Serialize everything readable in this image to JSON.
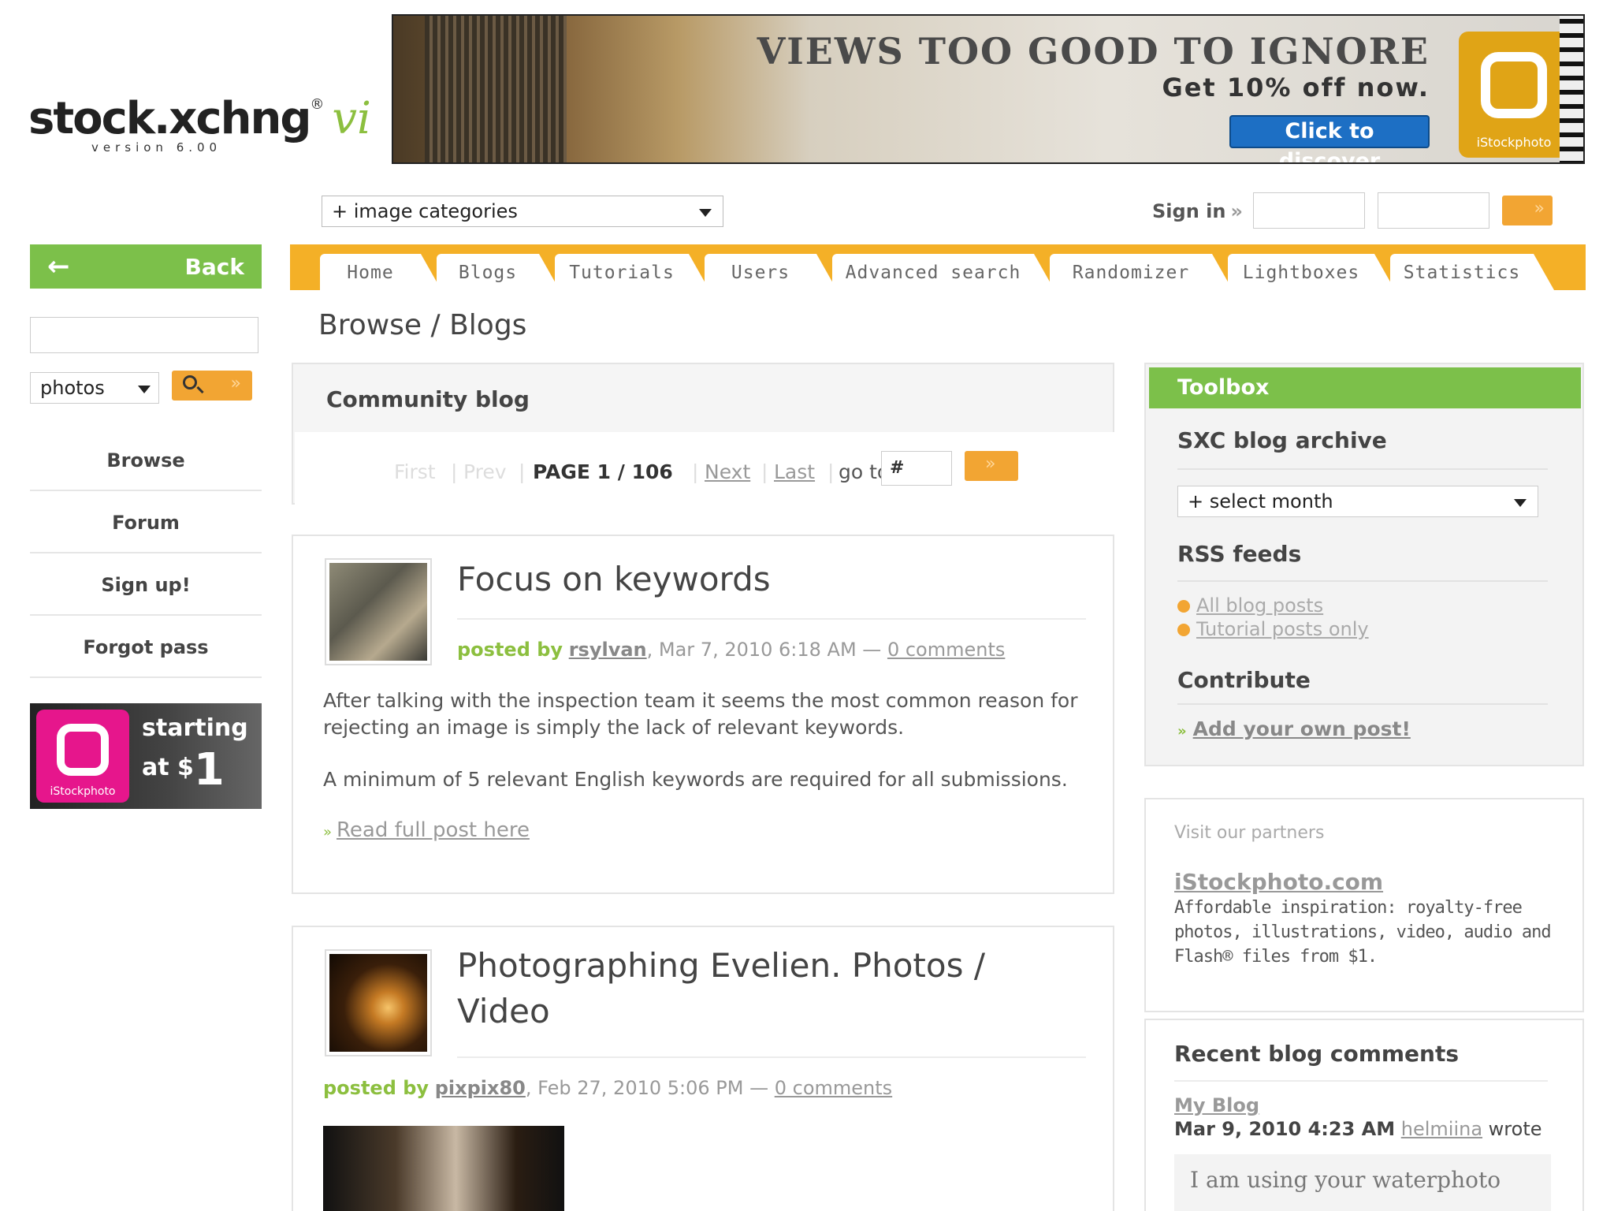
{
  "logo": {
    "name": "stock.xchng",
    "registered": "®",
    "suffix": "vi",
    "version": "version 6.00"
  },
  "banner": {
    "headline": "VIEWS TOO GOOD TO IGNORE",
    "subline": "Get 10% off now.",
    "cta": "Click to discover",
    "brand": "iStockphoto"
  },
  "header": {
    "category_select": "+ image categories",
    "signin_label": "Sign in",
    "signin_arrow": "»"
  },
  "left": {
    "back_label": "Back",
    "type_select": "photos",
    "nav": [
      "Browse",
      "Forum",
      "Sign up!",
      "Forgot pass"
    ],
    "ad": {
      "line1": "starting",
      "line2_prefix": "at $",
      "line2_big": "1",
      "brand": "iStockphoto"
    }
  },
  "tabs": [
    "Home",
    "Blogs",
    "Tutorials",
    "Users",
    "Advanced search",
    "Randomizer",
    "Lightboxes",
    "Statistics"
  ],
  "page_title": "Browse / Blogs",
  "community": {
    "heading": "Community blog",
    "first": "First",
    "prev": "Prev",
    "sep": "|",
    "page_label": "PAGE 1 / 106",
    "next": "Next",
    "last": "Last",
    "goto_label": "go to",
    "goto_value": "#"
  },
  "posts": [
    {
      "title": "Focus on keywords",
      "posted_by": "posted by",
      "author": "rsylvan",
      "date": ", Mar 7, 2010 6:18 AM —",
      "comments": "0 comments",
      "body1": "After talking with the inspection team it seems the most common reason for rejecting an image is simply the lack of relevant keywords.",
      "body2": "A minimum of 5 relevant English keywords are required for all submissions.",
      "readmore": "Read full post here"
    },
    {
      "title": "Photographing Evelien. Photos / Video",
      "posted_by": "posted by",
      "author": "pixpix80",
      "date": ", Feb 27, 2010 5:06 PM —",
      "comments": "0 comments"
    }
  ],
  "toolbox": {
    "title": "Toolbox",
    "archive_heading": "SXC blog archive",
    "month_select": "+ select month",
    "rss_heading": "RSS feeds",
    "rss": [
      "All blog posts",
      "Tutorial posts only"
    ],
    "contribute_heading": "Contribute",
    "add_post": "Add your own post!"
  },
  "partners": {
    "heading": "Visit our partners",
    "link": "iStockphoto.com",
    "desc": "Affordable inspiration: royalty-free photos, illustrations, video, audio and Flash® files from $1."
  },
  "recent": {
    "heading": "Recent blog comments",
    "blog": "My Blog",
    "date": "Mar 9, 2010 4:23 AM",
    "user": "helmiina",
    "wrote": "wrote",
    "quote": "I am using your waterphoto"
  },
  "colors": {
    "green": "#7cc04a",
    "orange": "#f4b027",
    "button_orange": "#f2a533",
    "cta_blue": "#1d6fc4",
    "pink": "#e6168c"
  }
}
